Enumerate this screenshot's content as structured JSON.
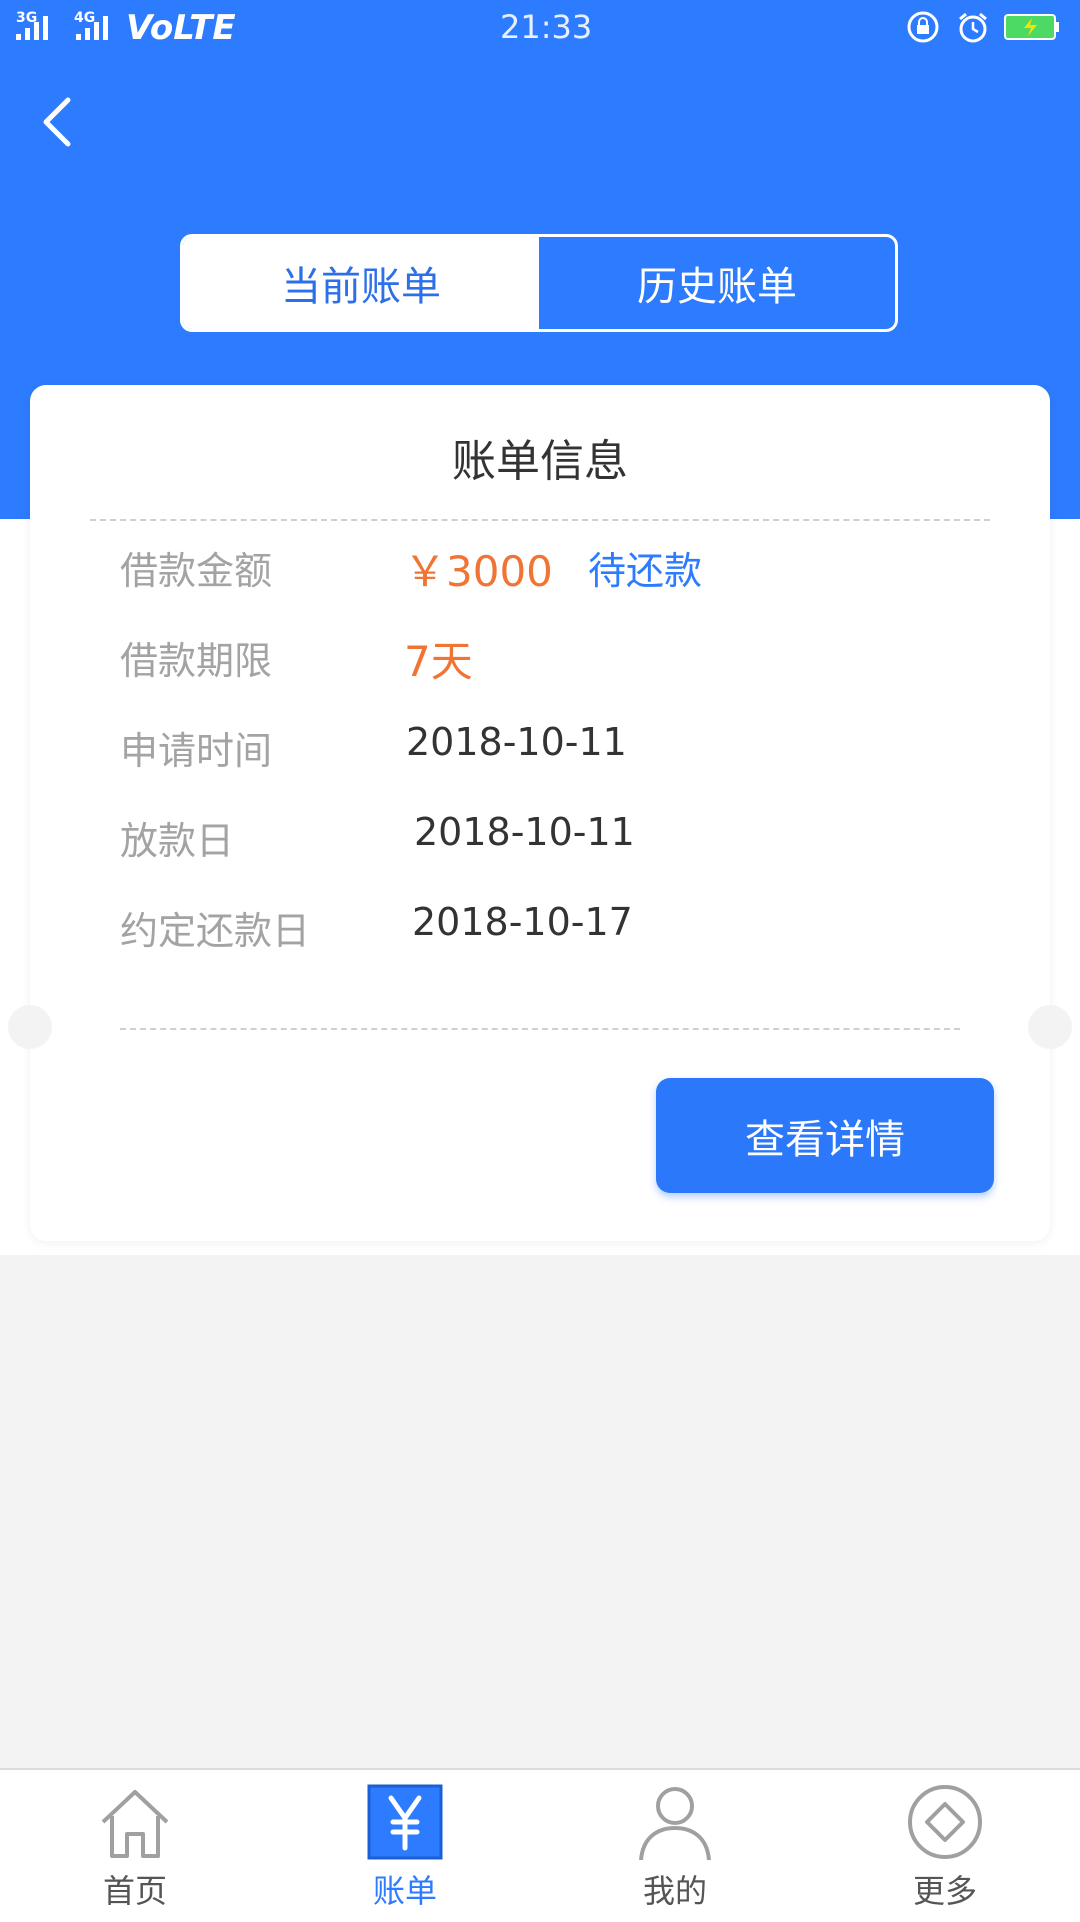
{
  "status_bar": {
    "signal_1": "3G",
    "signal_2": "4G",
    "network": "VoLTE",
    "time": "21:33"
  },
  "tabs": [
    {
      "label": "当前账单",
      "active": true
    },
    {
      "label": "历史账单",
      "active": false
    }
  ],
  "card": {
    "title": "账单信息",
    "rows": [
      {
        "label": "借款金额",
        "value": "￥3000",
        "tag": "待还款"
      },
      {
        "label": "借款期限",
        "value": "7天"
      },
      {
        "label": "申请时间",
        "value": "2018-10-11"
      },
      {
        "label": "放款日",
        "value": "2018-10-11"
      },
      {
        "label": "约定还款日",
        "value": "2018-10-17"
      }
    ],
    "details_button": "查看详情"
  },
  "bottom_nav": [
    {
      "label": "首页",
      "icon": "home-icon"
    },
    {
      "label": "账单",
      "icon": "yen-icon",
      "active": true
    },
    {
      "label": "我的",
      "icon": "user-icon"
    },
    {
      "label": "更多",
      "icon": "diamond-icon"
    }
  ],
  "colors": {
    "primary": "#2d7bff",
    "accent_orange": "#f07534",
    "label_gray": "#a3a3a3"
  }
}
